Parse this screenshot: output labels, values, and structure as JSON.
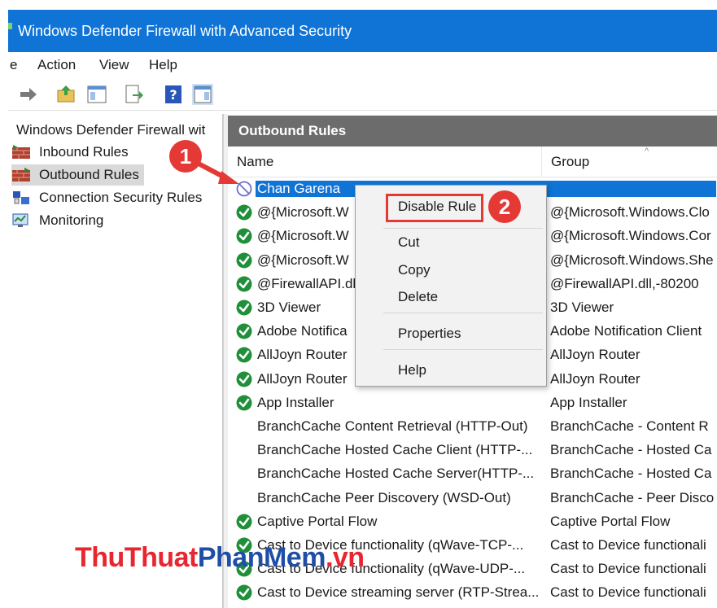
{
  "window": {
    "title": "Windows Defender Firewall with Advanced Security"
  },
  "menu": {
    "items": [
      "e",
      "Action",
      "View",
      "Help"
    ]
  },
  "toolbar": {
    "icons": [
      "forward-arrow-icon",
      "up-folder-icon",
      "show-hide-tree-icon",
      "export-list-icon",
      "help-icon",
      "show-hide-action-pane-icon"
    ]
  },
  "tree": {
    "root": "Windows Defender Firewall wit",
    "items": [
      {
        "label": "Inbound Rules",
        "icon": "inbound-rules-icon"
      },
      {
        "label": "Outbound Rules",
        "icon": "outbound-rules-icon",
        "selected": true
      },
      {
        "label": "Connection Security Rules",
        "icon": "connection-security-icon"
      },
      {
        "label": "Monitoring",
        "icon": "monitoring-icon"
      }
    ]
  },
  "rules_panel": {
    "header": "Outbound Rules",
    "columns": {
      "name": "Name",
      "group": "Group"
    },
    "rows": [
      {
        "name": "Chan Garena",
        "group": "",
        "status": "blocked",
        "selected": true
      },
      {
        "name": "@{Microsoft.W",
        "group": "@{Microsoft.Windows.Clo",
        "status": "enabled"
      },
      {
        "name": "@{Microsoft.W",
        "group": "@{Microsoft.Windows.Cor",
        "status": "enabled"
      },
      {
        "name": "@{Microsoft.W",
        "group": "@{Microsoft.Windows.She",
        "status": "enabled"
      },
      {
        "name": "@FirewallAPI.dl",
        "group": "@FirewallAPI.dll,-80200",
        "status": "enabled"
      },
      {
        "name": "3D Viewer",
        "group": "3D Viewer",
        "status": "enabled"
      },
      {
        "name": "Adobe Notifica",
        "group": "Adobe Notification Client",
        "status": "enabled"
      },
      {
        "name": "AllJoyn Router",
        "group": "AllJoyn Router",
        "status": "enabled"
      },
      {
        "name": "AllJoyn Router",
        "group": "AllJoyn Router",
        "status": "enabled"
      },
      {
        "name": "App Installer",
        "group": "App Installer",
        "status": "enabled"
      },
      {
        "name": "BranchCache Content Retrieval (HTTP-Out)",
        "group": "BranchCache - Content R",
        "status": "none"
      },
      {
        "name": "BranchCache Hosted Cache Client (HTTP-...",
        "group": "BranchCache - Hosted Ca",
        "status": "none"
      },
      {
        "name": "BranchCache Hosted Cache Server(HTTP-...",
        "group": "BranchCache - Hosted Ca",
        "status": "none"
      },
      {
        "name": "BranchCache Peer Discovery (WSD-Out)",
        "group": "BranchCache - Peer Disco",
        "status": "none"
      },
      {
        "name": "Captive Portal Flow",
        "group": "Captive Portal Flow",
        "status": "enabled"
      },
      {
        "name": "Cast to Device functionality (qWave-TCP-...",
        "group": "Cast to Device functionali",
        "status": "enabled"
      },
      {
        "name": "Cast to Device functionality (qWave-UDP-...",
        "group": "Cast to Device functionali",
        "status": "enabled"
      },
      {
        "name": "Cast to Device streaming server (RTP-Strea...",
        "group": "Cast to Device functionali",
        "status": "enabled"
      }
    ]
  },
  "context_menu": {
    "items": [
      "Disable Rule",
      "Cut",
      "Copy",
      "Delete",
      "Properties",
      "Help"
    ]
  },
  "annotations": {
    "step1": "1",
    "step2": "2",
    "accent": "#e53935"
  },
  "watermark": {
    "part1": "ThuThuat",
    "part2": "PhanMem",
    "part3": ".vn"
  },
  "colors": {
    "titlebar": "#0f74d6",
    "selection": "#0f74d6",
    "panel_header": "#6c6c6c",
    "enabled_check": "#1f8f3a"
  }
}
